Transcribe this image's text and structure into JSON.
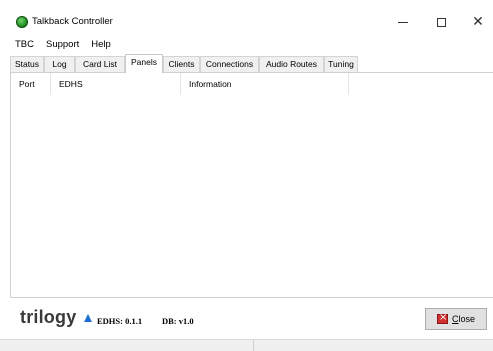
{
  "window": {
    "title": "Talkback Controller",
    "icon": "green-globe-icon",
    "controls": {
      "minimize": "minimize-icon",
      "maximize": "maximize-icon",
      "close": "close-icon"
    }
  },
  "menubar": {
    "items": [
      "TBC",
      "Support",
      "Help"
    ]
  },
  "tabs": [
    {
      "label": "Status",
      "active": false
    },
    {
      "label": "Log",
      "active": false
    },
    {
      "label": "Card List",
      "active": false
    },
    {
      "label": "Panels",
      "active": true
    },
    {
      "label": "Clients",
      "active": false
    },
    {
      "label": "Connections",
      "active": false
    },
    {
      "label": "Audio Routes",
      "active": false
    },
    {
      "label": "Tuning",
      "active": false
    }
  ],
  "panels_table": {
    "columns": [
      "Port",
      "EDHS",
      "Information"
    ],
    "rows": []
  },
  "footer": {
    "logo_text": "trilogy",
    "edhs_version": "EDHS: 0.1.1",
    "db_version": "DB: v1.0",
    "close_button_label": "Close",
    "accent_color": "#1e6fd1"
  }
}
